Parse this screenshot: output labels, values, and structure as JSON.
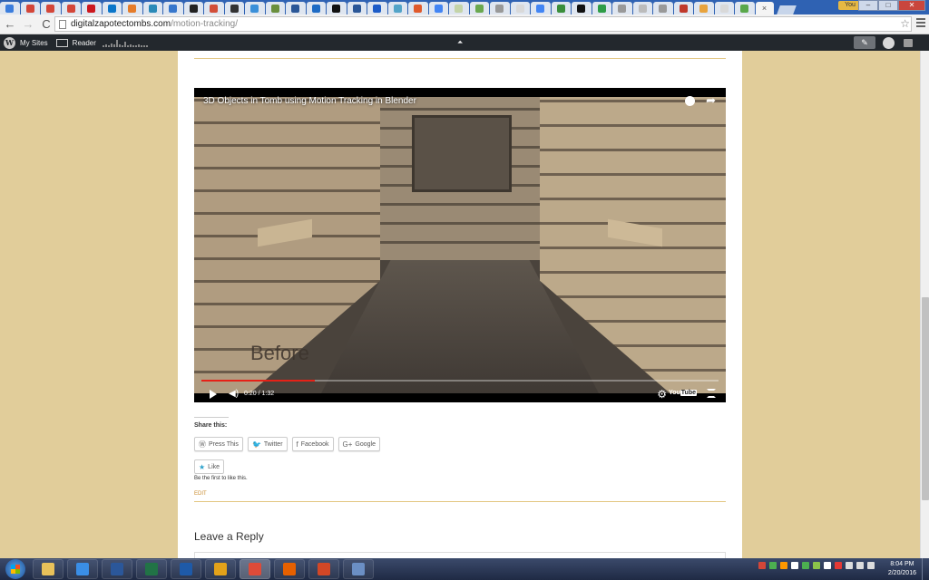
{
  "browser": {
    "tab_favicon_colors": [
      "#3b7ddd",
      "#d44638",
      "#d44638",
      "#d44638",
      "#cc181e",
      "#0b76c9",
      "#e57c2a",
      "#2a8ab8",
      "#3777cc",
      "#222222",
      "#d24e38",
      "#333333",
      "#3b90d9",
      "#6a8f3d",
      "#2b5797",
      "#1e6bc4",
      "#111111",
      "#2b5797",
      "#1d5cc7",
      "#53a4c8",
      "#e05a2b",
      "#4285f4",
      "#c4d4a8",
      "#6aa84f",
      "#999999",
      "#d9d9d9",
      "#4285f4",
      "#3b8e3b",
      "#111111",
      "#2f9d47",
      "#999999",
      "#bbbbbb",
      "#999999",
      "#c0392b",
      "#e8a33d",
      "#d9d9d9",
      "#5aa84a"
    ],
    "active_tab_close": "×",
    "user_badge": "You",
    "window_buttons": [
      "–",
      "□",
      "✕"
    ],
    "back_icon": "←",
    "forward_icon": "→",
    "reload_icon": "C",
    "url_host": "digitalzapotectombs.com",
    "url_path": "/motion-tracking/",
    "bookmark_star": "☆"
  },
  "admin_bar": {
    "logo": "W",
    "my_sites": "My Sites",
    "reader": "Reader",
    "sparkline": [
      2,
      3,
      2,
      4,
      3,
      8,
      3,
      2,
      6,
      2,
      3,
      2,
      2,
      3,
      2,
      2,
      2
    ],
    "center_icon": "⏶",
    "write_icon": "✎"
  },
  "video": {
    "title": "3D Objects in Tomb using Motion Tracking in Blender",
    "share_icon": "➦",
    "overlay_text": "Before",
    "progress_fraction": 0.22,
    "time": "0:20 / 1:32",
    "volume_icon": "◀)",
    "settings_icon": "⚙",
    "youtube_logo": "You",
    "youtube_logo_tube": "Tube"
  },
  "share": {
    "label": "Share this:",
    "buttons": [
      {
        "icon": "Ⓦ",
        "label": "Press This"
      },
      {
        "icon": "🐦",
        "label": "Twitter"
      },
      {
        "icon": "f",
        "label": "Facebook"
      },
      {
        "icon": "G+",
        "label": "Google"
      }
    ]
  },
  "like": {
    "icon": "★",
    "label": "Like",
    "note": "Be the first to like this."
  },
  "edit_link": "EDIT",
  "reply": {
    "title": "Leave a Reply"
  },
  "taskbar": {
    "apps": [
      {
        "name": "explorer",
        "color": "#e8c15a"
      },
      {
        "name": "internet-explorer",
        "color": "#3a8ee6"
      },
      {
        "name": "word",
        "color": "#2b579a"
      },
      {
        "name": "excel",
        "color": "#217346"
      },
      {
        "name": "app-blue",
        "color": "#1e5aa8"
      },
      {
        "name": "outlook",
        "color": "#e3a21a"
      },
      {
        "name": "chrome",
        "color": "#dd4b39"
      },
      {
        "name": "firefox",
        "color": "#e66000"
      },
      {
        "name": "powerpoint",
        "color": "#d24726"
      },
      {
        "name": "window",
        "color": "#6b8fc4"
      }
    ],
    "active_app_index": 6,
    "tray_colors": [
      "#d44638",
      "#4caf50",
      "#ff9800",
      "#ffffff",
      "#4caf50",
      "#8bc34a",
      "#ffffff",
      "#e53935",
      "#dddddd",
      "#dddddd",
      "#dddddd"
    ],
    "time": "8:04 PM",
    "date": "2/20/2016"
  }
}
